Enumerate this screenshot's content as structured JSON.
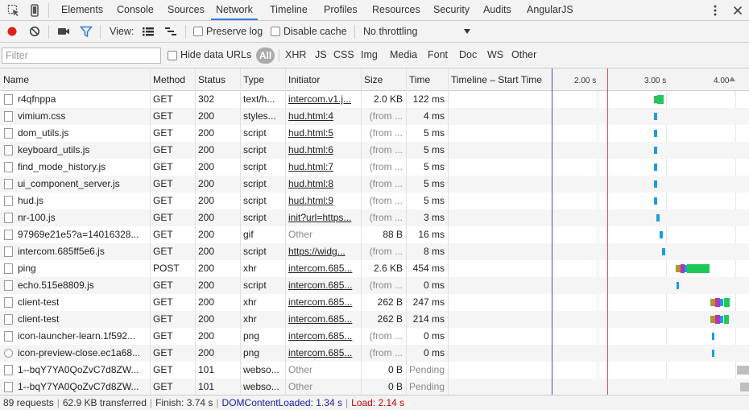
{
  "tabs": [
    "Elements",
    "Console",
    "Sources",
    "Network",
    "Timeline",
    "Profiles",
    "Resources",
    "Security",
    "Audits",
    "AngularJS"
  ],
  "active_tab": "Network",
  "toolbar": {
    "view_label": "View:",
    "preserve_log": "Preserve log",
    "disable_cache": "Disable cache",
    "throttling": "No throttling"
  },
  "filterbar": {
    "placeholder": "Filter",
    "hide_data_urls": "Hide data URLs",
    "types": [
      "All",
      "XHR",
      "JS",
      "CSS",
      "Img",
      "Media",
      "Font",
      "Doc",
      "WS",
      "Other"
    ]
  },
  "columns": [
    "Name",
    "Method",
    "Status",
    "Type",
    "Initiator",
    "Size",
    "Time",
    "Timeline – Start Time"
  ],
  "timeline_ticks": [
    "2.00 s",
    "3.00 s",
    "4.00"
  ],
  "colors": {
    "dom_content_loaded": "#1a1aa6",
    "load": "#c80000",
    "accent": "#3879d9"
  },
  "rows": [
    {
      "name": "r4qfnppa",
      "method": "GET",
      "status": "302",
      "type": "text/h...",
      "initiator": "intercom.v1.j...",
      "size": "2.0 KB",
      "time": "122 ms",
      "icon": "file-icon"
    },
    {
      "name": "vimium.css",
      "method": "GET",
      "status": "200",
      "type": "styles...",
      "initiator": "hud.html:4",
      "size": "(from ...",
      "time": "4 ms",
      "icon": "file-icon"
    },
    {
      "name": "dom_utils.js",
      "method": "GET",
      "status": "200",
      "type": "script",
      "initiator": "hud.html:5",
      "size": "(from ...",
      "time": "5 ms",
      "icon": "file-icon"
    },
    {
      "name": "keyboard_utils.js",
      "method": "GET",
      "status": "200",
      "type": "script",
      "initiator": "hud.html:6",
      "size": "(from ...",
      "time": "5 ms",
      "icon": "file-icon"
    },
    {
      "name": "find_mode_history.js",
      "method": "GET",
      "status": "200",
      "type": "script",
      "initiator": "hud.html:7",
      "size": "(from ...",
      "time": "5 ms",
      "icon": "file-icon"
    },
    {
      "name": "ui_component_server.js",
      "method": "GET",
      "status": "200",
      "type": "script",
      "initiator": "hud.html:8",
      "size": "(from ...",
      "time": "5 ms",
      "icon": "file-icon"
    },
    {
      "name": "hud.js",
      "method": "GET",
      "status": "200",
      "type": "script",
      "initiator": "hud.html:9",
      "size": "(from ...",
      "time": "5 ms",
      "icon": "file-icon"
    },
    {
      "name": "nr-100.js",
      "method": "GET",
      "status": "200",
      "type": "script",
      "initiator": "init?url=https...",
      "size": "(from ...",
      "time": "3 ms",
      "icon": "file-icon"
    },
    {
      "name": "97969e21e5?a=14016328...",
      "method": "GET",
      "status": "200",
      "type": "gif",
      "initiator": "Other",
      "size": "88 B",
      "time": "16 ms",
      "icon": "file-icon"
    },
    {
      "name": "intercom.685ff5e6.js",
      "method": "GET",
      "status": "200",
      "type": "script",
      "initiator": "https://widg...",
      "size": "(from ...",
      "time": "8 ms",
      "icon": "file-icon"
    },
    {
      "name": "ping",
      "method": "POST",
      "status": "200",
      "type": "xhr",
      "initiator": "intercom.685...",
      "size": "2.6 KB",
      "time": "454 ms",
      "icon": "file-icon"
    },
    {
      "name": "echo.515e8809.js",
      "method": "GET",
      "status": "200",
      "type": "script",
      "initiator": "intercom.685...",
      "size": "(from ...",
      "time": "0 ms",
      "icon": "file-icon"
    },
    {
      "name": "client-test",
      "method": "GET",
      "status": "200",
      "type": "xhr",
      "initiator": "intercom.685...",
      "size": "262 B",
      "time": "247 ms",
      "icon": "file-icon"
    },
    {
      "name": "client-test",
      "method": "GET",
      "status": "200",
      "type": "xhr",
      "initiator": "intercom.685...",
      "size": "262 B",
      "time": "214 ms",
      "icon": "file-icon"
    },
    {
      "name": "icon-launcher-learn.1f592...",
      "method": "GET",
      "status": "200",
      "type": "png",
      "initiator": "intercom.685...",
      "size": "(from ...",
      "time": "0 ms",
      "icon": "file-icon"
    },
    {
      "name": "icon-preview-close.ec1a68...",
      "method": "GET",
      "status": "200",
      "type": "png",
      "initiator": "intercom.685...",
      "size": "(from ...",
      "time": "0 ms",
      "icon": "image-icon"
    },
    {
      "name": "1--bqY7YA0QoZvC7d8ZW...",
      "method": "GET",
      "status": "101",
      "type": "webso...",
      "initiator": "Other",
      "size": "0 B",
      "time": "Pending",
      "icon": "file-icon"
    },
    {
      "name": "1--bqY7YA0QoZvC7d8ZW...",
      "method": "GET",
      "status": "101",
      "type": "webso...",
      "initiator": "Other",
      "size": "0 B",
      "time": "Pending",
      "icon": "file-icon"
    }
  ],
  "status_bar": {
    "requests": "89 requests",
    "transferred": "62.9 KB transferred",
    "finish": "Finish: 3.74 s",
    "dom_content_loaded": "DOMContentLoaded: 1.34 s",
    "load": "Load: 2.14 s"
  }
}
